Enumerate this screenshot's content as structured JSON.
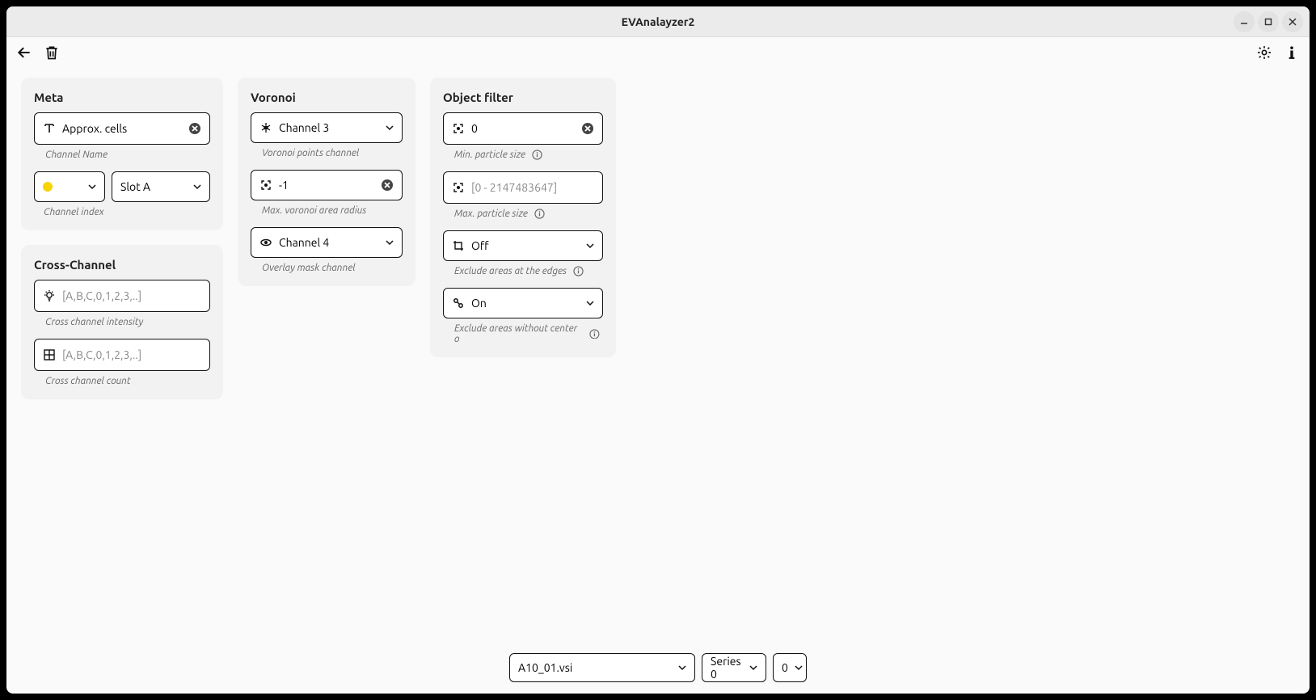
{
  "window": {
    "title": "EVAnalayzer2"
  },
  "panels": {
    "meta": {
      "title": "Meta",
      "channel_name": {
        "value": "Approx. cells",
        "hint": "Channel Name"
      },
      "color_select": {
        "value": ""
      },
      "slot_select": {
        "value": "Slot A"
      },
      "channel_index_hint": "Channel index"
    },
    "cross": {
      "title": "Cross-Channel",
      "intensity": {
        "placeholder": "[A,B,C,0,1,2,3,..]",
        "hint": "Cross channel intensity"
      },
      "count": {
        "placeholder": "[A,B,C,0,1,2,3,..]",
        "hint": "Cross channel count"
      }
    },
    "voronoi": {
      "title": "Voronoi",
      "points_channel": {
        "value": "Channel 3",
        "hint": "Voronoi points channel"
      },
      "max_radius": {
        "value": "-1",
        "hint": "Max. voronoi area radius"
      },
      "overlay_mask": {
        "value": "Channel 4",
        "hint": "Overlay mask channel"
      }
    },
    "objfilter": {
      "title": "Object filter",
      "min_particle": {
        "value": "0",
        "hint": "Min. particle size"
      },
      "max_particle": {
        "placeholder": "[0 - 2147483647]",
        "hint": "Max. particle size"
      },
      "exclude_edges": {
        "value": "Off",
        "hint": "Exclude areas at the edges"
      },
      "exclude_center": {
        "value": "On",
        "hint": "Exclude areas without center o"
      }
    }
  },
  "footer": {
    "file": "A10_01.vsi",
    "series": "Series 0",
    "index": "0"
  }
}
